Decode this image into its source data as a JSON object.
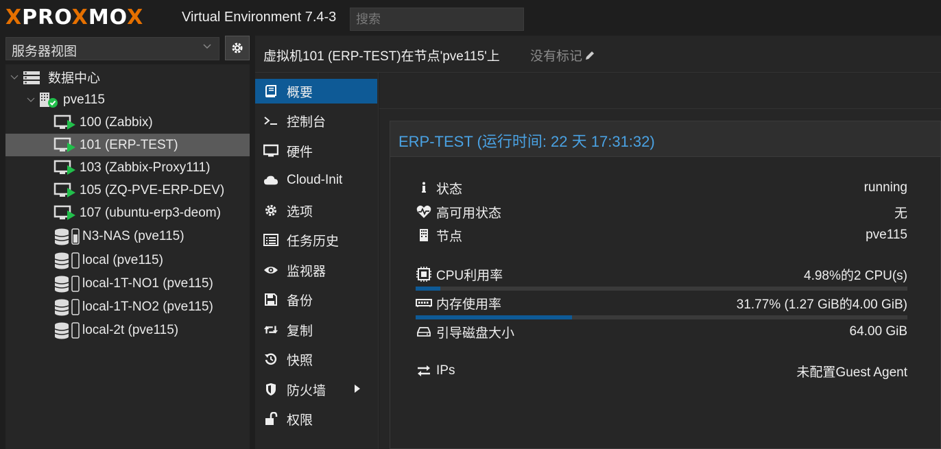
{
  "header": {
    "logo_prefix": "PRO",
    "logo_x": "X",
    "logo_mid": "MO",
    "logo_x2": "X",
    "version": "Virtual Environment 7.4-3",
    "search_placeholder": "搜索"
  },
  "left": {
    "view_select": "服务器视图",
    "tree": [
      {
        "label": "数据中心",
        "icon": "datacenter-icon"
      },
      {
        "label": "pve115",
        "icon": "node-online-icon"
      },
      {
        "label": "100 (Zabbix)",
        "icon": "vm-running-icon"
      },
      {
        "label": "101 (ERP-TEST)",
        "icon": "vm-running-icon"
      },
      {
        "label": "103 (Zabbix-Proxy111)",
        "icon": "vm-running-icon"
      },
      {
        "label": "105 (ZQ-PVE-ERP-DEV)",
        "icon": "vm-running-icon"
      },
      {
        "label": "107 (ubuntu-erp3-deom)",
        "icon": "vm-running-icon"
      },
      {
        "label": "N3-NAS (pve115)",
        "icon": "storage-icon"
      },
      {
        "label": "local (pve115)",
        "icon": "storage-icon"
      },
      {
        "label": "local-1T-NO1 (pve115)",
        "icon": "storage-icon"
      },
      {
        "label": "local-1T-NO2 (pve115)",
        "icon": "storage-icon"
      },
      {
        "label": "local-2t (pve115)",
        "icon": "storage-icon"
      }
    ]
  },
  "content": {
    "title": "虚拟机101 (ERP-TEST)在节点'pve115'上",
    "tags": "没有标记"
  },
  "menu": [
    {
      "label": "概要",
      "icon": "book-icon"
    },
    {
      "label": "控制台",
      "icon": "terminal-icon"
    },
    {
      "label": "硬件",
      "icon": "monitor-icon"
    },
    {
      "label": "Cloud-Init",
      "icon": "cloud-icon"
    },
    {
      "label": "选项",
      "icon": "gear-icon"
    },
    {
      "label": "任务历史",
      "icon": "list-icon"
    },
    {
      "label": "监视器",
      "icon": "eye-icon"
    },
    {
      "label": "备份",
      "icon": "floppy-icon"
    },
    {
      "label": "复制",
      "icon": "retweet-icon"
    },
    {
      "label": "快照",
      "icon": "history-icon"
    },
    {
      "label": "防火墙",
      "icon": "shield-icon"
    },
    {
      "label": "权限",
      "icon": "unlock-icon"
    }
  ],
  "summary": {
    "heading": "ERP-TEST (运行时间: 22 天 17:31:32)",
    "status_label": "状态",
    "status_value": "running",
    "ha_label": "高可用状态",
    "ha_value": "无",
    "node_label": "节点",
    "node_value": "pve115",
    "cpu_label": "CPU利用率",
    "cpu_value": "4.98%的2 CPU(s)",
    "cpu_fraction": 0.0498,
    "mem_label": "内存使用率",
    "mem_value": "31.77% (1.27 GiB的4.00 GiB)",
    "mem_fraction": 0.3177,
    "disk_label": "引导磁盘大小",
    "disk_value": "64.00 GiB",
    "ips_label": "IPs",
    "ips_value": "未配置Guest Agent"
  },
  "colors": {
    "accent": "#0e5a96",
    "running": "#21bf4b",
    "heading": "#4aa2e3",
    "logo_orange": "#e57000"
  }
}
